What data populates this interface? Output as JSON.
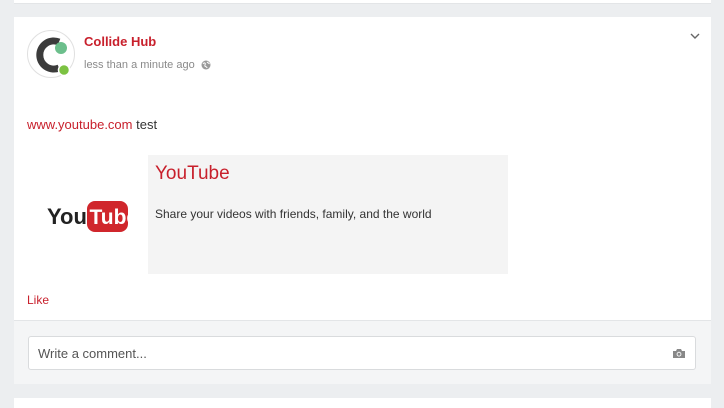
{
  "post": {
    "author": "Collide Hub",
    "timestamp": "less than a minute ago",
    "text_link": "www.youtube.com",
    "text_rest": " test",
    "like_label": "Like"
  },
  "link_preview": {
    "logo_text_you": "You",
    "logo_text_tube": "Tube",
    "title": "YouTube",
    "description": "Share your videos with friends, family, and the world"
  },
  "comment": {
    "placeholder": "Write a comment..."
  },
  "icons": {
    "avatar": "collide-hub-logo",
    "privacy": "globe-icon",
    "menu": "chevron-down-icon",
    "attach": "camera-icon"
  },
  "colors": {
    "accent": "#c8202c",
    "youtube_red": "#d0262c",
    "online": "#7cc242"
  }
}
